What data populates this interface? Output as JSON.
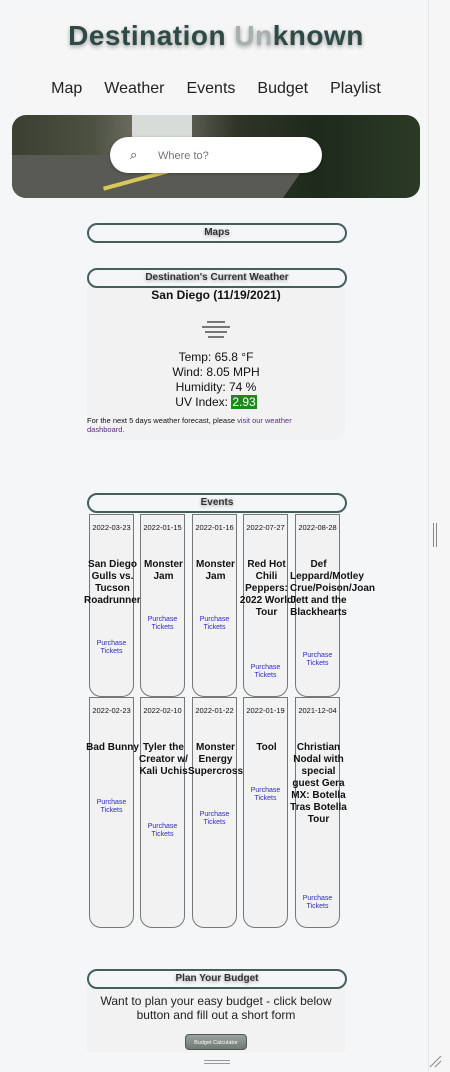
{
  "header": {
    "title_part1": "Destination ",
    "title_part2": "Un",
    "title_part3": "known",
    "nav": [
      "Map",
      "Weather",
      "Events",
      "Budget",
      "Playlist"
    ]
  },
  "search": {
    "placeholder": "Where to?"
  },
  "sections": {
    "maps": "Maps",
    "weather": "Destination's Current Weather",
    "events": "Events",
    "budget": "Plan Your Budget"
  },
  "weather": {
    "city": "San Diego (11/19/2021)",
    "icon": "fog-icon",
    "temp": "Temp: 65.8 °F",
    "wind": "Wind: 8.05 MPH",
    "humidity": "Humidity: 74 %",
    "uv_label": "UV Index: ",
    "uv_value": "2.93",
    "uv_color": "#1a8a1a",
    "note_text": "For the next 5 days weather forecast, please ",
    "note_link": "visit our weather dashboard."
  },
  "events": [
    {
      "date": "2022-03-23",
      "name": "San Diego Gulls vs. Tucson Roadrunners",
      "link": "Purchase Tickets"
    },
    {
      "date": "2022-01-15",
      "name": "Monster Jam",
      "link": "Purchase Tickets"
    },
    {
      "date": "2022-01-16",
      "name": "Monster Jam",
      "link": "Purchase Tickets"
    },
    {
      "date": "2022-07-27",
      "name": "Red Hot Chili Peppers: 2022 World Tour",
      "link": "Purchase Tickets"
    },
    {
      "date": "2022-08-28",
      "name": "Def Leppard/Motley Crue/Poison/Joan Jett and the Blackhearts",
      "link": "Purchase Tickets"
    },
    {
      "date": "2022-02-23",
      "name": "Bad Bunny",
      "link": "Purchase Tickets"
    },
    {
      "date": "2022-02-10",
      "name": "Tyler the Creator w/ Kali Uchis",
      "link": "Purchase Tickets"
    },
    {
      "date": "2022-01-22",
      "name": "Monster Energy Supercross",
      "link": "Purchase Tickets"
    },
    {
      "date": "2022-01-19",
      "name": "Tool",
      "link": "Purchase Tickets"
    },
    {
      "date": "2021-12-04",
      "name": "Christian Nodal with special guest Gera MX: Botella Tras Botella Tour",
      "link": "Purchase Tickets"
    }
  ],
  "budget": {
    "text": "Want to plan your easy budget - click below button and fill out a short form",
    "button": "Budget Calculator"
  }
}
